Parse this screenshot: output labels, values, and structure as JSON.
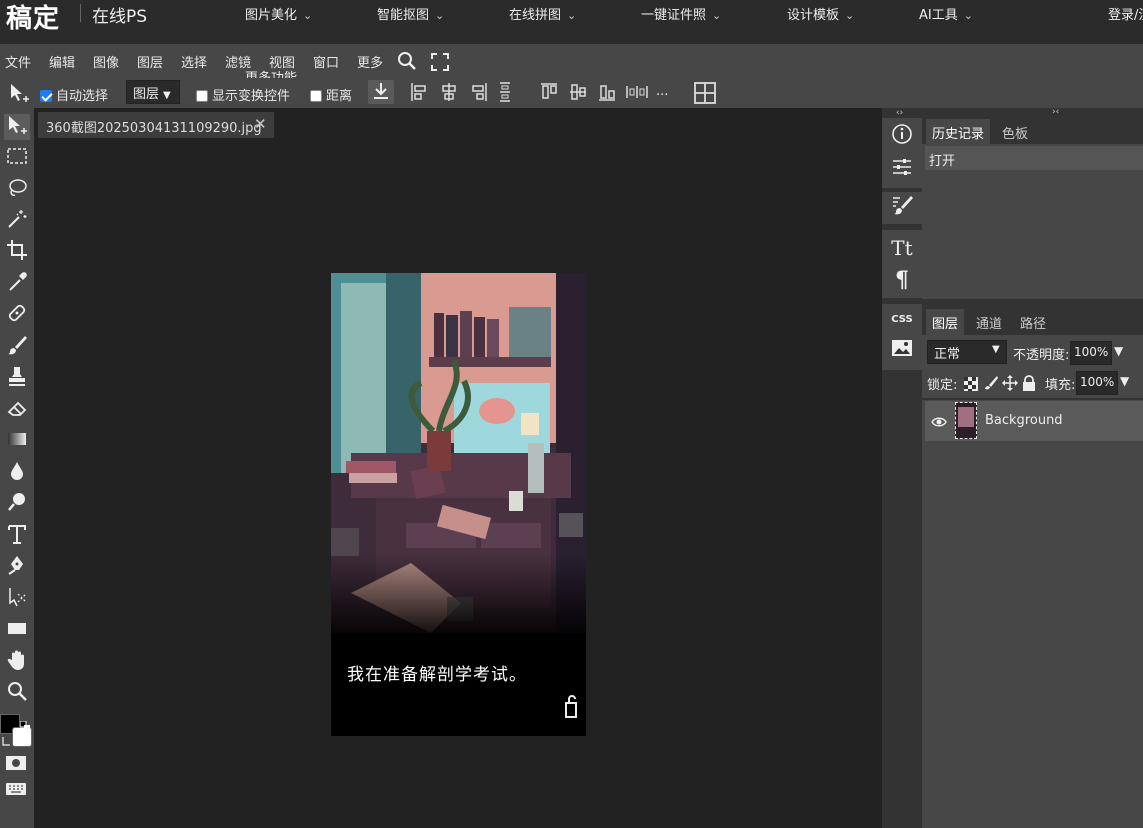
{
  "topnav": {
    "logo": "稿定",
    "product": "在线PS",
    "items": [
      "图片美化",
      "智能抠图",
      "在线拼图",
      "一键证件照",
      "设计模板",
      "AI工具"
    ],
    "login": "登录/注"
  },
  "menubar": {
    "items": [
      "文件",
      "编辑",
      "图像",
      "图层",
      "选择",
      "滤镜",
      "视图",
      "窗口",
      "更多"
    ],
    "more_features": "更多功能"
  },
  "options": {
    "auto_select_label": "自动选择",
    "auto_select_checked": true,
    "target_select": "图层",
    "show_transform_label": "显示变换控件",
    "show_transform_checked": false,
    "distance_label": "距离",
    "distance_checked": false,
    "more": "..."
  },
  "document": {
    "tab_title": "360截图20250304131109290.jpg",
    "subtitle_text": "我在准备解剖学考试。"
  },
  "panels": {
    "history_tab": "历史记录",
    "swatches_tab": "色板",
    "history_items": [
      "打开"
    ],
    "layers_tab": "图层",
    "channels_tab": "通道",
    "paths_tab": "路径",
    "blend_mode": "正常",
    "opacity_label": "不透明度:",
    "opacity_value": "100%",
    "lock_label": "锁定:",
    "fill_label": "填充:",
    "fill_value": "100%",
    "layers": [
      {
        "name": "Background",
        "visible": true
      }
    ]
  },
  "colors": {
    "foreground": "#000000",
    "background": "#ffffff",
    "accent": "#1e7cf0"
  }
}
